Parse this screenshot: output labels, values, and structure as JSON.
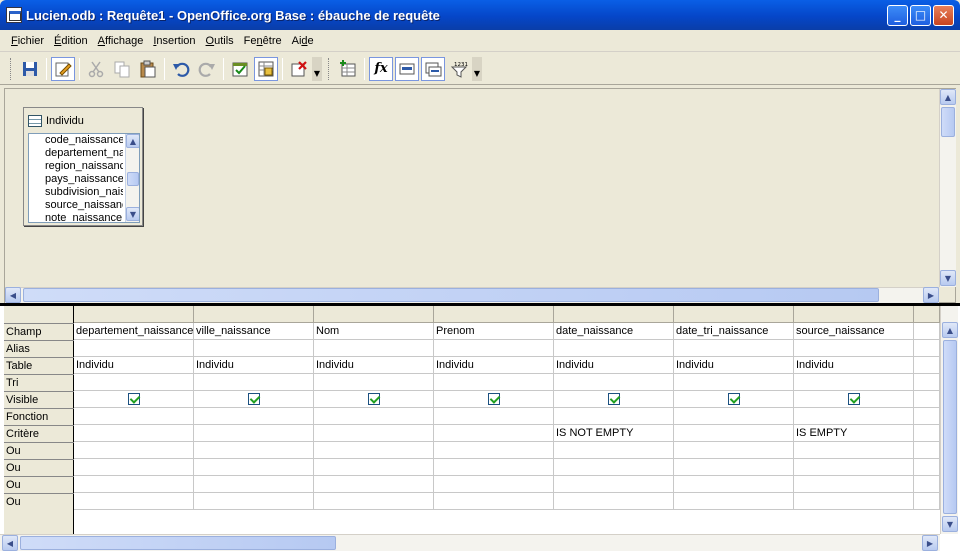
{
  "window": {
    "title": "Lucien.odb : Requête1 - OpenOffice.org Base : ébauche de requête"
  },
  "menu": [
    {
      "key": "F",
      "rest": "ichier"
    },
    {
      "key": "É",
      "rest": "dition"
    },
    {
      "key": "A",
      "rest": "ffichage"
    },
    {
      "key": "I",
      "rest": "nsertion"
    },
    {
      "key": "O",
      "rest": "utils"
    },
    {
      "key": "",
      "pre": "Fe",
      "rkey": "n",
      "rest": "être"
    },
    {
      "key": "",
      "pre": "Ai",
      "rkey": "d",
      "rest": "e"
    }
  ],
  "toolbar": {
    "function_label": "fx",
    "numbers_label": "1231"
  },
  "table_window": {
    "name": "Individu",
    "fields": [
      "code_naissance",
      "departement_naissance",
      "region_naissance",
      "pays_naissance",
      "subdivision_naissance",
      "source_naissance",
      "note_naissance"
    ]
  },
  "grid": {
    "row_labels": [
      "Champ",
      "Alias",
      "Table",
      "Tri",
      "Visible",
      "Fonction",
      "Critère",
      "Ou",
      "Ou",
      "Ou",
      "Ou"
    ],
    "columns": [
      {
        "field": "departement_naissance",
        "table": "Individu",
        "visible": true,
        "criteria": ""
      },
      {
        "field": "ville_naissance",
        "table": "Individu",
        "visible": true,
        "criteria": ""
      },
      {
        "field": "Nom",
        "table": "Individu",
        "visible": true,
        "criteria": ""
      },
      {
        "field": "Prenom",
        "table": "Individu",
        "visible": true,
        "criteria": ""
      },
      {
        "field": "date_naissance",
        "table": "Individu",
        "visible": true,
        "criteria": "IS NOT EMPTY"
      },
      {
        "field": "date_tri_naissance",
        "table": "Individu",
        "visible": true,
        "criteria": ""
      },
      {
        "field": "source_naissance",
        "table": "Individu",
        "visible": true,
        "criteria": "IS EMPTY"
      }
    ]
  }
}
